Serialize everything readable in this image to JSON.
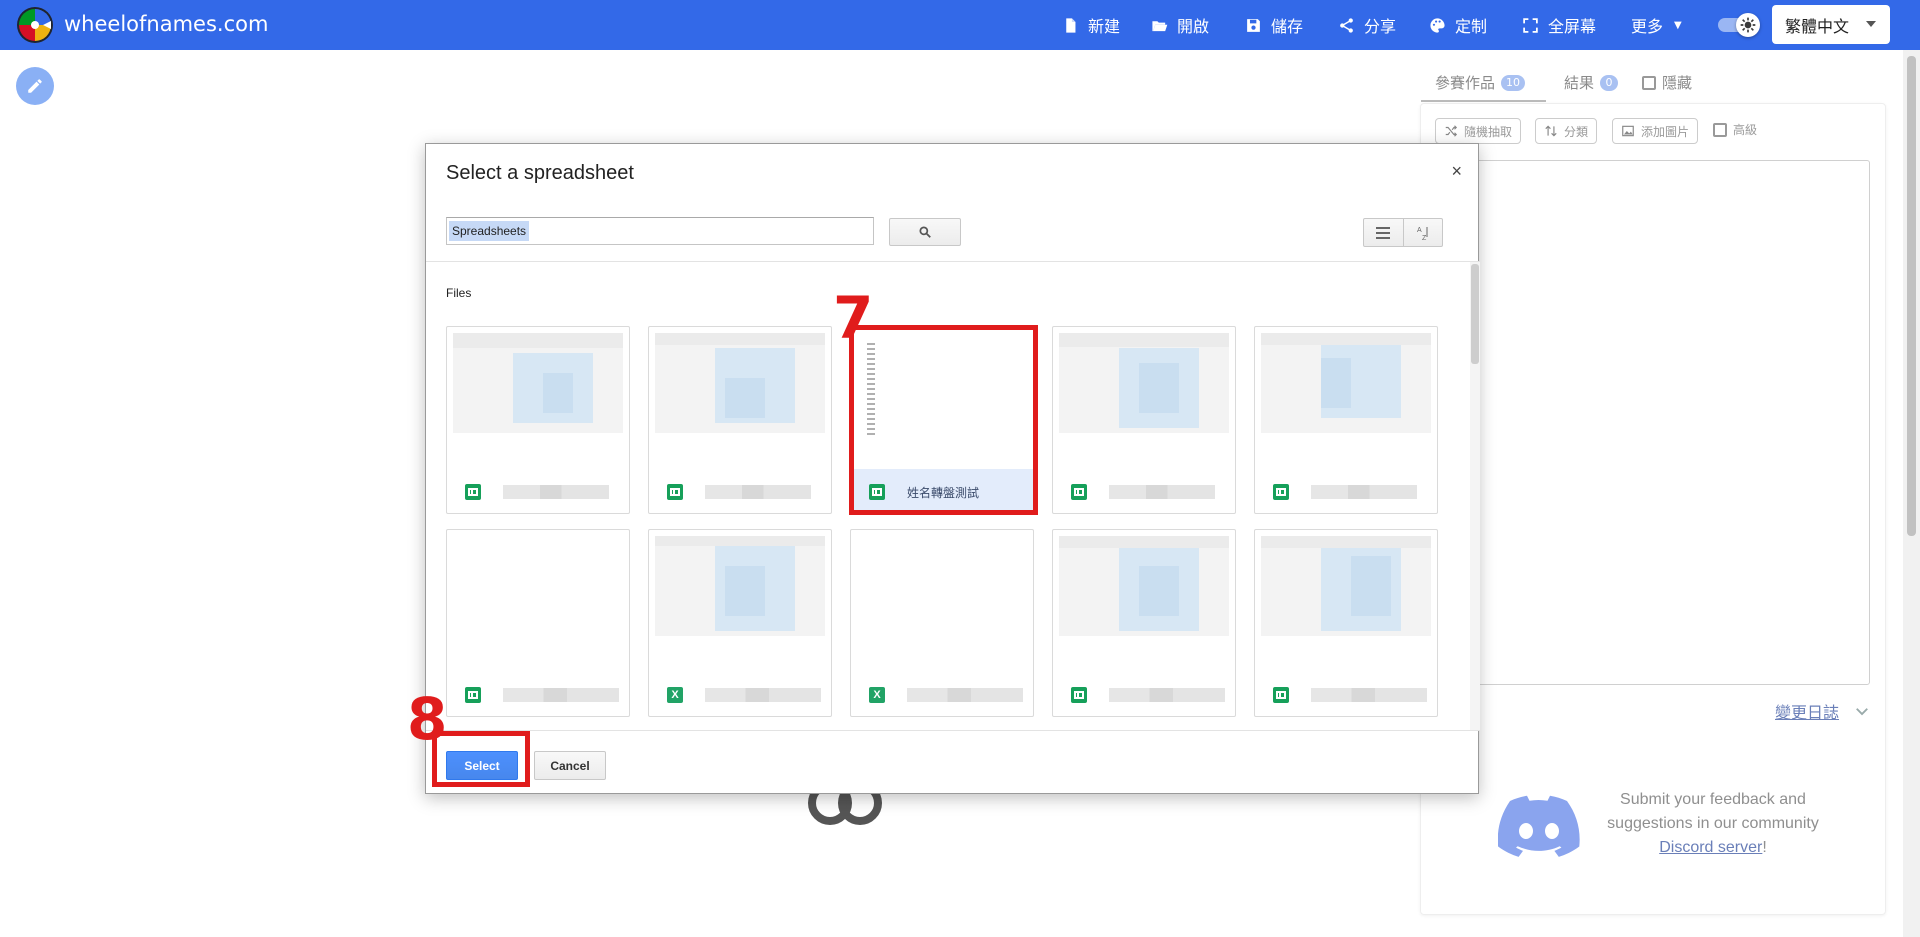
{
  "header": {
    "site_title": "wheelofnames.com",
    "nav": [
      {
        "label": "新建",
        "icon": "file-icon"
      },
      {
        "label": "開啟",
        "icon": "folder-open-icon"
      },
      {
        "label": "儲存",
        "icon": "save-icon"
      },
      {
        "label": "分享",
        "icon": "share-icon"
      },
      {
        "label": "定制",
        "icon": "palette-icon"
      },
      {
        "label": "全屏幕",
        "icon": "fullscreen-icon"
      },
      {
        "label": "更多",
        "icon": "chevron-down-icon"
      }
    ],
    "language": "繁體中文"
  },
  "right_panel": {
    "tabs": [
      {
        "label": "參賽作品",
        "count": "10"
      },
      {
        "label": "結果",
        "count": "0"
      },
      {
        "label": "隱藏"
      }
    ],
    "toolbar": [
      {
        "label": "隨機抽取",
        "icon": "shuffle-icon"
      },
      {
        "label": "分類",
        "icon": "sort-icon"
      },
      {
        "label": "添加圖片",
        "icon": "image-icon"
      }
    ],
    "advanced_label": "高級",
    "changelog_link": "變更日誌",
    "fragment": "2",
    "feedback_line1": "Submit your feedback and",
    "feedback_line2": "suggestions in our community",
    "feedback_link": "Discord server",
    "feedback_end": "!"
  },
  "dialog": {
    "title": "Select a spreadsheet",
    "close": "×",
    "search_value": "Spreadsheets",
    "section_label": "Files",
    "selected_file_name": "姓名轉盤測試",
    "select_button": "Select",
    "cancel_button": "Cancel"
  },
  "annotations": {
    "step_a": "7",
    "step_b": "8"
  },
  "colors": {
    "brand": "#3369e8",
    "annotation": "#e01c1c",
    "select_button": "#4787ed"
  }
}
